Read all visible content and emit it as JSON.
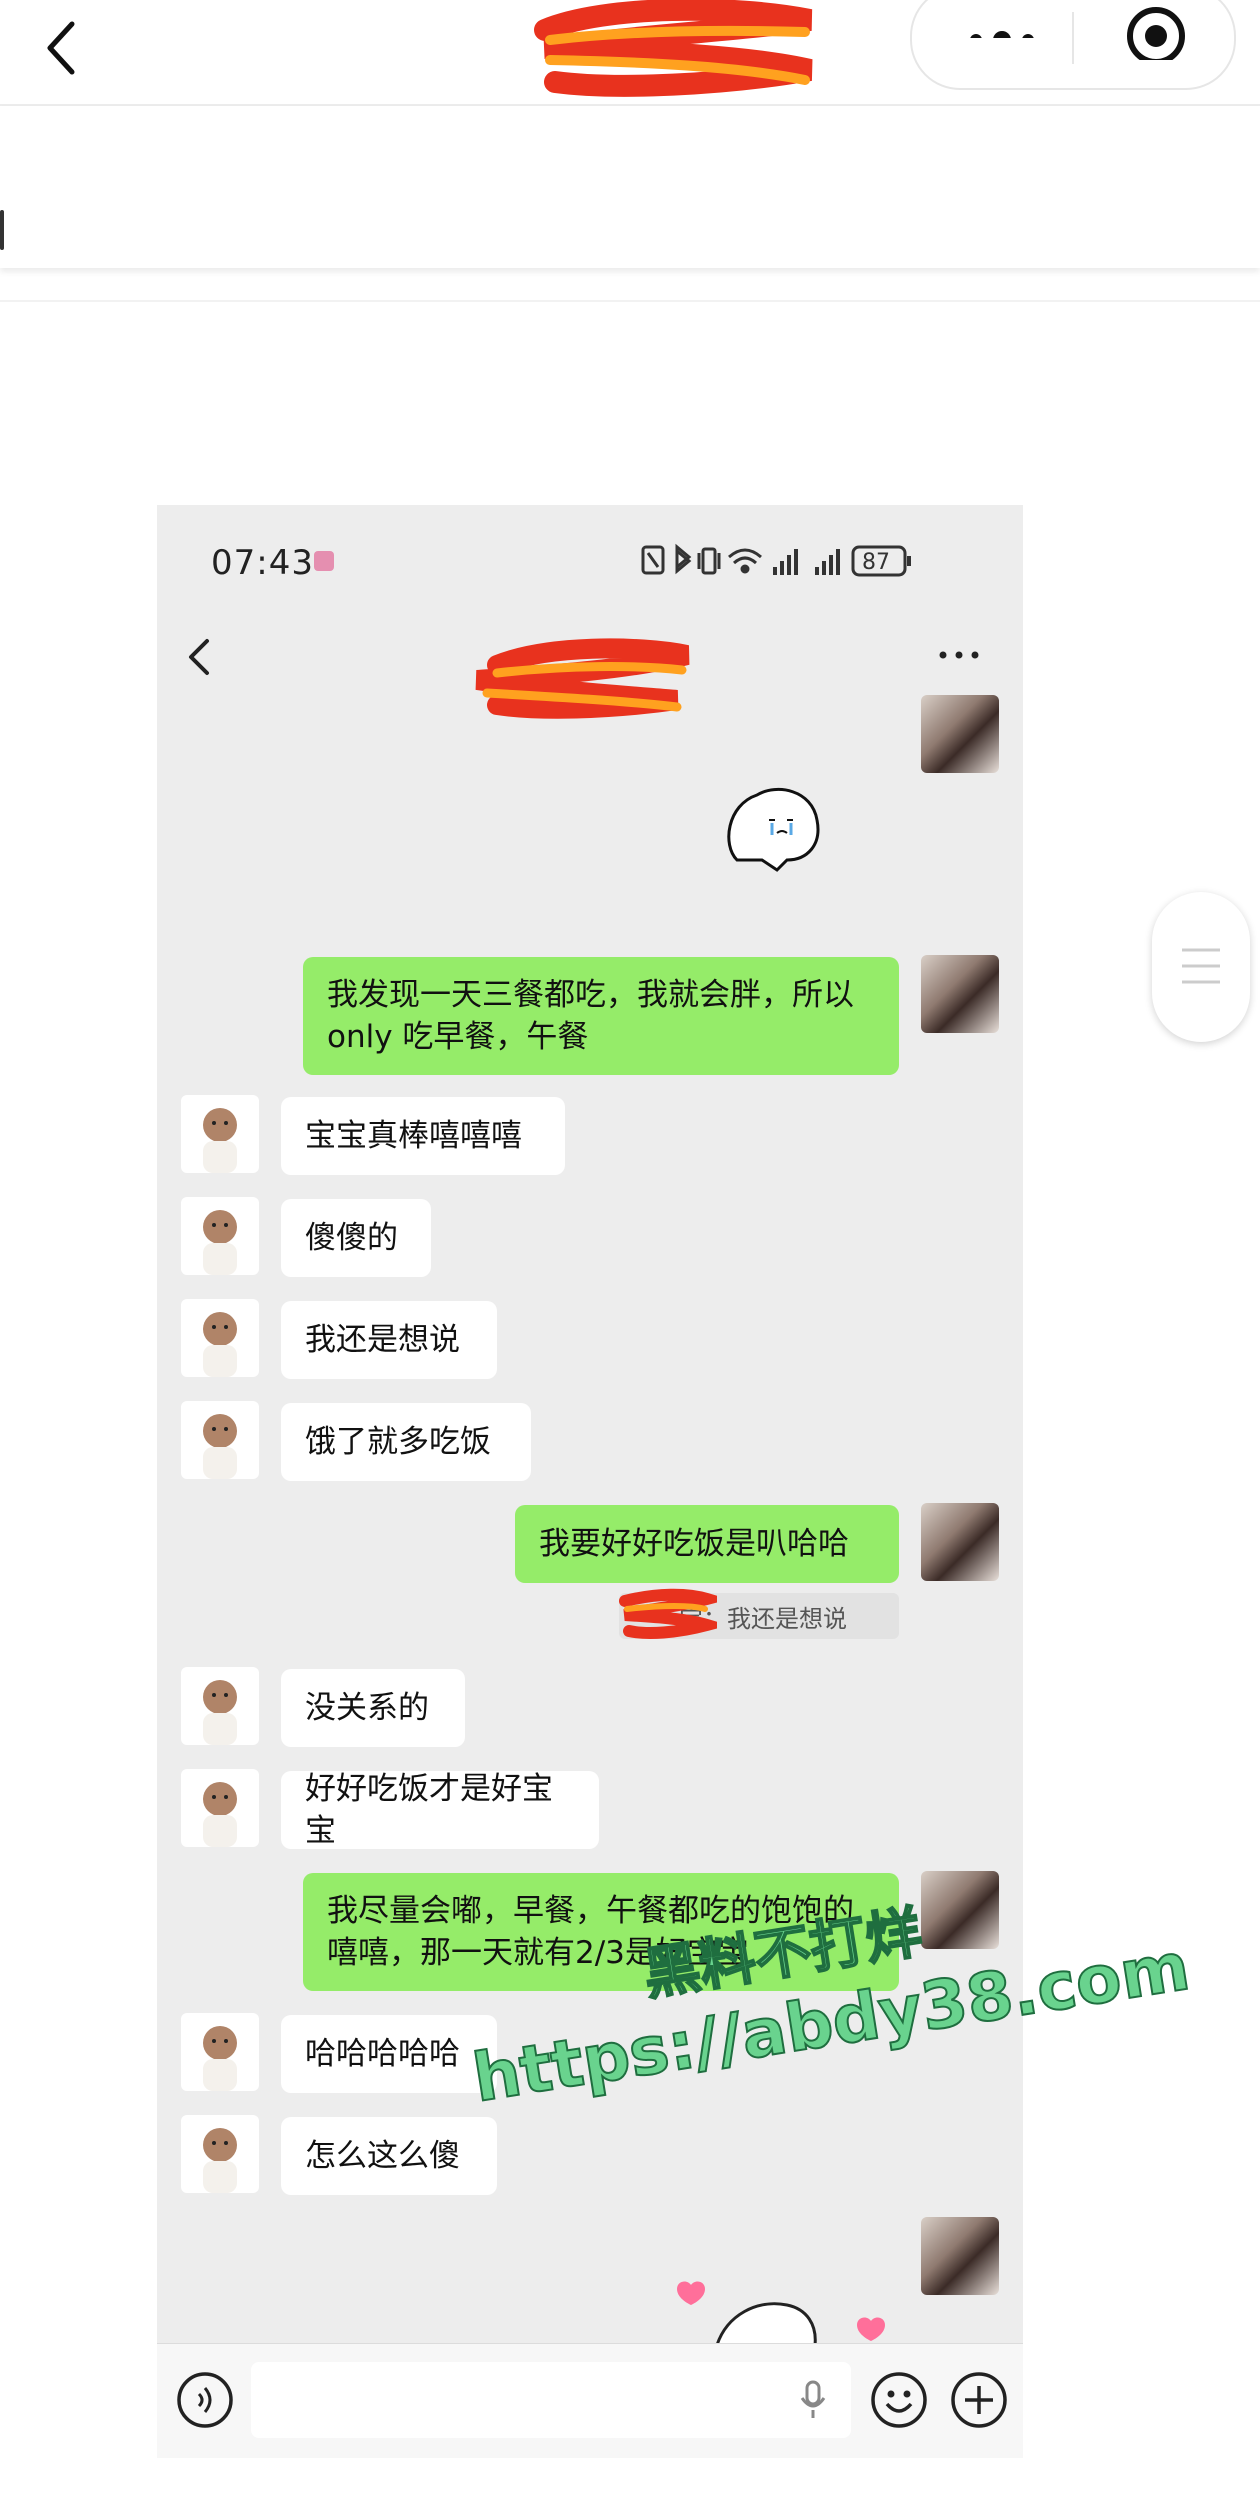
{
  "phone": {
    "status_time": "07:43",
    "battery": "87",
    "messages": [
      {
        "side": "me",
        "text": "我发现一天三餐都吃，我就会胖，所以only 吃早餐，午餐"
      },
      {
        "side": "other",
        "text": "宝宝真棒嘻嘻嘻"
      },
      {
        "side": "other",
        "text": "傻傻的"
      },
      {
        "side": "other",
        "text": "我还是想说"
      },
      {
        "side": "other",
        "text": "饿了就多吃饭"
      },
      {
        "side": "me",
        "text": "我要好好吃饭是叭哈哈"
      },
      {
        "side": "other",
        "text": "没关系的"
      },
      {
        "side": "other",
        "text": "好好吃饭才是好宝宝"
      },
      {
        "side": "me",
        "text": "我尽量会嘟，早餐，午餐都吃的饱饱的嘻嘻，那一天就有2/3是好宝宝"
      },
      {
        "side": "other",
        "text": "哈哈哈哈哈"
      },
      {
        "side": "other",
        "text": "怎么这么傻"
      }
    ],
    "quote": "宝：我还是想说"
  },
  "watermark": {
    "line1": "黑料不打烊",
    "line2": "https://abdy38.com"
  },
  "icons": {
    "back": "chevron-left-icon",
    "more": "more-dots-icon",
    "target": "target-icon",
    "voice": "voice-icon",
    "mic": "mic-icon",
    "emoji": "emoji-icon",
    "plus": "plus-icon"
  }
}
